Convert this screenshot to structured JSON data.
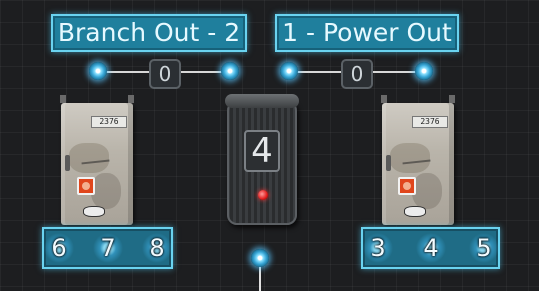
{
  "blocks": {
    "left": {
      "title": "Branch Out - 2",
      "counter": "0"
    },
    "right": {
      "title": "1 - Power Out",
      "counter": "0"
    }
  },
  "hub": {
    "value": "4"
  },
  "panels": {
    "left": {
      "sticker": "2376",
      "ports": [
        "6",
        "7",
        "8"
      ]
    },
    "right": {
      "sticker": "2376",
      "ports": [
        "3",
        "4",
        "5"
      ]
    }
  },
  "colors": {
    "accent": "#6ad3f0",
    "box_fill": "#1f7f9d",
    "led": "#e01a1a"
  },
  "icons": {
    "node": "glowing-connector-node",
    "warning": "warning-sticker-icon"
  }
}
